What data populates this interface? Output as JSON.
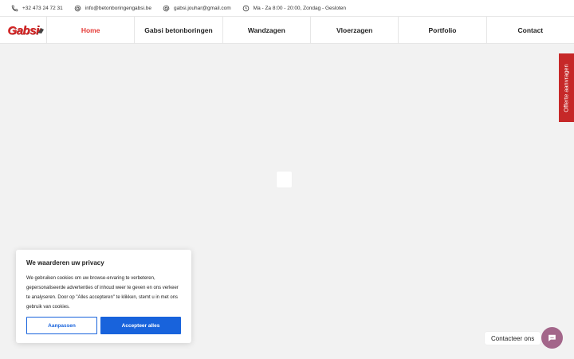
{
  "topbar": {
    "phone": "+32 473 24 72 31",
    "email1": "info@betonboringengabsi.be",
    "email2": "gabsi.jouhar@gmail.com",
    "hours": "Ma - Za 8:00 - 20:00, Zondag - Gesloten",
    "icons": [
      "phone-icon",
      "at-icon",
      "at-icon",
      "clock-icon"
    ]
  },
  "logo": {
    "text": "Gabsi"
  },
  "nav": {
    "items": [
      {
        "label": "Home",
        "active": true
      },
      {
        "label": "Gabsi betonboringen"
      },
      {
        "label": "Wandzagen"
      },
      {
        "label": "Vloerzagen"
      },
      {
        "label": "Portfolio"
      },
      {
        "label": "Contact"
      }
    ]
  },
  "side_tab": {
    "label": "Offerte aanvragen"
  },
  "cookie": {
    "title": "We waarderen uw privacy",
    "text": "We gebruiken cookies om uw browse-ervaring te verbeteren, gepersonaliseerde advertenties of inhoud weer te geven en ons verkeer te analyseren. Door op \"Alles accepteren\" te klikken, stemt u in met ons gebruik van cookies.",
    "customize_label": "Aanpassen",
    "accept_label": "Accepteer alles"
  },
  "contact_widget": {
    "label": "Contacteer ons"
  },
  "colors": {
    "accent_red": "#e53935",
    "side_tab_red": "#c62828",
    "button_blue": "#1863dc",
    "fab_purple": "#a3668a",
    "page_background": "#f2f2f2"
  }
}
